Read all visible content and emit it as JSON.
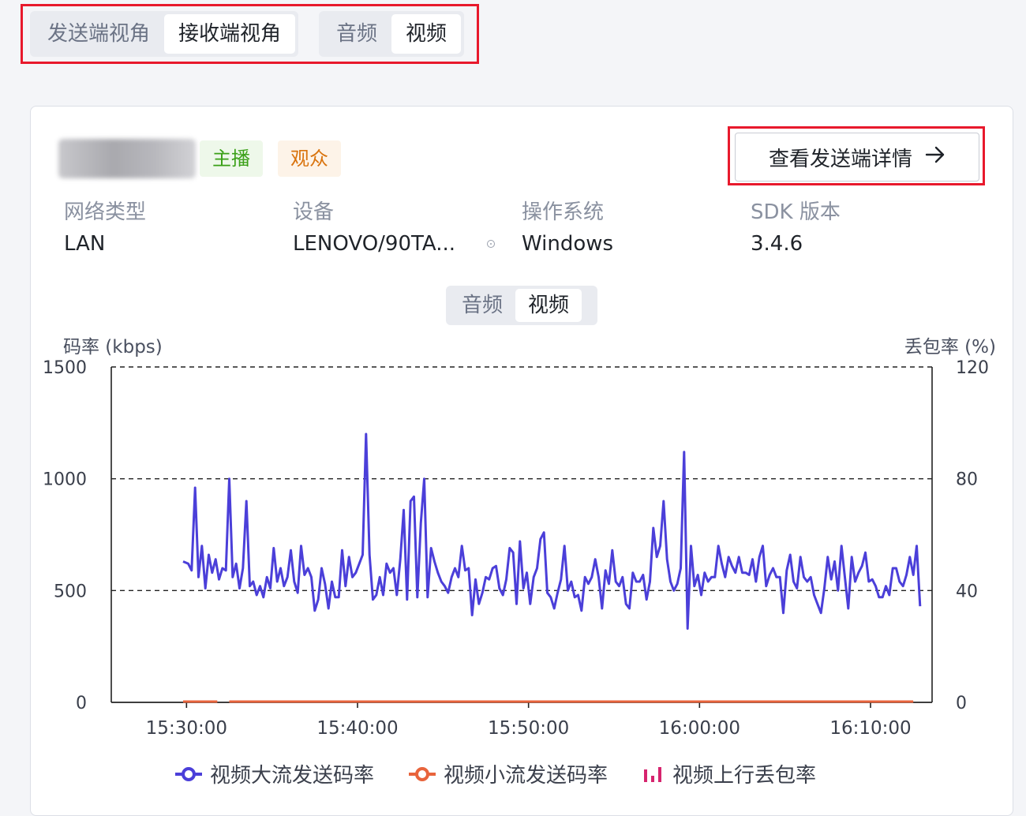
{
  "perspective_tabs": [
    "发送端视角",
    "接收端视角"
  ],
  "perspective_active": 1,
  "media_tabs": [
    "音频",
    "视频"
  ],
  "media_active": 1,
  "user": {
    "tags": {
      "host": "主播",
      "audience": "观众"
    }
  },
  "detail_button": {
    "label": "查看发送端详情",
    "icon": "arrow-right-icon"
  },
  "info": {
    "network": {
      "label": "网络类型",
      "value": "LAN"
    },
    "device": {
      "label": "设备",
      "value": "LENOVO/90TA..."
    },
    "os": {
      "label": "操作系统",
      "value": "Windows"
    },
    "sdk": {
      "label": "SDK 版本",
      "value": "3.4.6"
    }
  },
  "chart_tabs": [
    "音频",
    "视频"
  ],
  "chart_tab_active": 1,
  "colors": {
    "accent": "#4b3fd9",
    "small_stream": "#e8643c",
    "loss": "#d6246e",
    "highlight": "#e8192c"
  },
  "chart_data": {
    "type": "line",
    "ylabel_left": "码率 (kbps)",
    "ylabel_right": "丢包率 (%)",
    "y_left_ticks": [
      0,
      500,
      1000,
      1500
    ],
    "y_right_ticks": [
      0,
      40,
      80,
      120
    ],
    "ylim_left": [
      0,
      1500
    ],
    "ylim_right": [
      0,
      120
    ],
    "x_ticks": [
      "15:30:00",
      "15:40:00",
      "15:50:00",
      "16:00:00",
      "16:10:00"
    ],
    "xlim_minutes_from_1530": [
      -4.4,
      43.6
    ],
    "grid": "dashed-horizontal",
    "legend_position": "bottom",
    "series": [
      {
        "name": "视频大流发送码率",
        "x_minutes_from_1530": [
          -0.2,
          0.1,
          0.3,
          0.5,
          0.7,
          0.9,
          1.1,
          1.3,
          1.5,
          1.7,
          1.9,
          2.1,
          2.3,
          2.5,
          2.7,
          2.9,
          3.1,
          3.3,
          3.5,
          3.7,
          3.9,
          4.1,
          4.3,
          4.5,
          4.7,
          4.9,
          5.1,
          5.3,
          5.5,
          5.7,
          5.9,
          6.1,
          6.3,
          6.5,
          6.7,
          6.9,
          7.1,
          7.3,
          7.5,
          7.7,
          7.9,
          8.1,
          8.3,
          8.5,
          8.7,
          8.9,
          9.1,
          9.3,
          9.5,
          9.7,
          9.9,
          10.1,
          10.3,
          10.5,
          10.7,
          10.9,
          11.1,
          11.3,
          11.5,
          11.7,
          11.9,
          12.1,
          12.3,
          12.5,
          12.7,
          12.9,
          13.1,
          13.3,
          13.5,
          13.7,
          13.9,
          14.1,
          14.3,
          14.5,
          14.7,
          14.9,
          15.1,
          15.3,
          15.5,
          15.7,
          15.9,
          16.1,
          16.3,
          16.5,
          16.7,
          16.9,
          17.1,
          17.3,
          17.5,
          17.7,
          17.9,
          18.1,
          18.3,
          18.5,
          18.7,
          18.9,
          19.1,
          19.3,
          19.5,
          19.7,
          19.9,
          20.1,
          20.3,
          20.5,
          20.7,
          20.9,
          21.1,
          21.3,
          21.5,
          21.7,
          21.9,
          22.1,
          22.3,
          22.5,
          22.7,
          22.9,
          23.1,
          23.3,
          23.5,
          23.7,
          23.9,
          24.1,
          24.3,
          24.5,
          24.7,
          24.9,
          25.1,
          25.3,
          25.5,
          25.7,
          25.9,
          26.1,
          26.3,
          26.5,
          26.7,
          26.9,
          27.1,
          27.3,
          27.5,
          27.7,
          27.9,
          28.1,
          28.3,
          28.5,
          28.7,
          28.9,
          29.1,
          29.3,
          29.5,
          29.7,
          29.9,
          30.1,
          30.3,
          30.5,
          30.7,
          30.9,
          31.1,
          31.3,
          31.5,
          31.7,
          31.9,
          32.1,
          32.3,
          32.5,
          32.7,
          32.9,
          33.1,
          33.3,
          33.5,
          33.7,
          33.9,
          34.1,
          34.3,
          34.5,
          34.7,
          34.9,
          35.1,
          35.3,
          35.5,
          35.7,
          35.9,
          36.1,
          36.3,
          36.5,
          36.7,
          36.9,
          37.1,
          37.3,
          37.5,
          37.7,
          37.9,
          38.1,
          38.3,
          38.5,
          38.7,
          38.9,
          39.1,
          39.3,
          39.5,
          39.7,
          39.9,
          40.1,
          40.3,
          40.5,
          40.7,
          40.9,
          41.1,
          41.3,
          41.5,
          41.7,
          41.9,
          42.1,
          42.3,
          42.5,
          42.7,
          42.9
        ],
        "values": [
          630,
          620,
          590,
          960,
          560,
          700,
          510,
          660,
          580,
          640,
          550,
          600,
          590,
          1000,
          560,
          620,
          510,
          600,
          900,
          520,
          540,
          480,
          520,
          470,
          560,
          510,
          690,
          540,
          600,
          520,
          560,
          680,
          540,
          490,
          700,
          570,
          600,
          560,
          410,
          460,
          600,
          530,
          420,
          540,
          470,
          470,
          680,
          520,
          650,
          560,
          580,
          620,
          660,
          1200,
          660,
          460,
          480,
          560,
          480,
          620,
          580,
          600,
          480,
          640,
          860,
          460,
          900,
          920,
          470,
          800,
          1000,
          470,
          690,
          630,
          580,
          540,
          520,
          490,
          560,
          600,
          560,
          700,
          590,
          600,
          390,
          550,
          440,
          490,
          560,
          550,
          600,
          610,
          510,
          480,
          550,
          690,
          670,
          440,
          720,
          510,
          580,
          440,
          560,
          600,
          730,
          760,
          490,
          470,
          420,
          490,
          550,
          700,
          500,
          540,
          470,
          480,
          410,
          560,
          530,
          560,
          640,
          560,
          420,
          590,
          530,
          680,
          540,
          520,
          560,
          440,
          420,
          580,
          540,
          540,
          570,
          460,
          540,
          780,
          650,
          700,
          900,
          640,
          540,
          500,
          530,
          600,
          1120,
          330,
          700,
          520,
          570,
          480,
          580,
          540,
          560,
          560,
          700,
          620,
          560,
          650,
          610,
          580,
          650,
          580,
          580,
          570,
          640,
          540,
          650,
          700,
          520,
          570,
          600,
          560,
          560,
          400,
          590,
          660,
          540,
          510,
          650,
          560,
          540,
          560,
          480,
          440,
          400,
          510,
          650,
          550,
          630,
          500,
          700,
          560,
          420,
          650,
          540,
          580,
          610,
          670,
          540,
          550,
          520,
          470,
          470,
          520,
          480,
          600,
          600,
          540,
          520,
          570,
          650,
          570,
          700,
          430,
          390,
          450,
          420,
          500,
          480,
          410,
          560,
          500,
          680,
          640,
          650,
          650,
          620,
          480,
          620,
          560,
          620,
          440,
          420,
          540,
          480,
          620,
          610,
          540,
          720,
          580,
          440,
          520,
          650,
          630,
          560,
          600,
          520,
          560,
          560,
          600,
          540,
          560,
          500,
          640,
          560,
          700,
          570,
          560,
          580,
          600,
          480,
          560,
          500,
          480,
          560,
          470,
          720,
          500,
          460,
          600,
          470,
          600,
          560,
          640,
          610,
          520,
          500,
          560,
          480,
          560,
          470,
          560,
          500,
          500,
          420,
          440,
          420,
          420,
          620,
          580,
          720,
          600,
          460
        ]
      },
      {
        "name": "视频小流发送码率",
        "x_minutes_from_1530": [
          -0.2,
          1.8,
          2.5,
          42.5
        ],
        "values": [
          0,
          0,
          0,
          0
        ]
      },
      {
        "name": "视频上行丢包率",
        "x_minutes_from_1530": [],
        "values": []
      }
    ]
  }
}
